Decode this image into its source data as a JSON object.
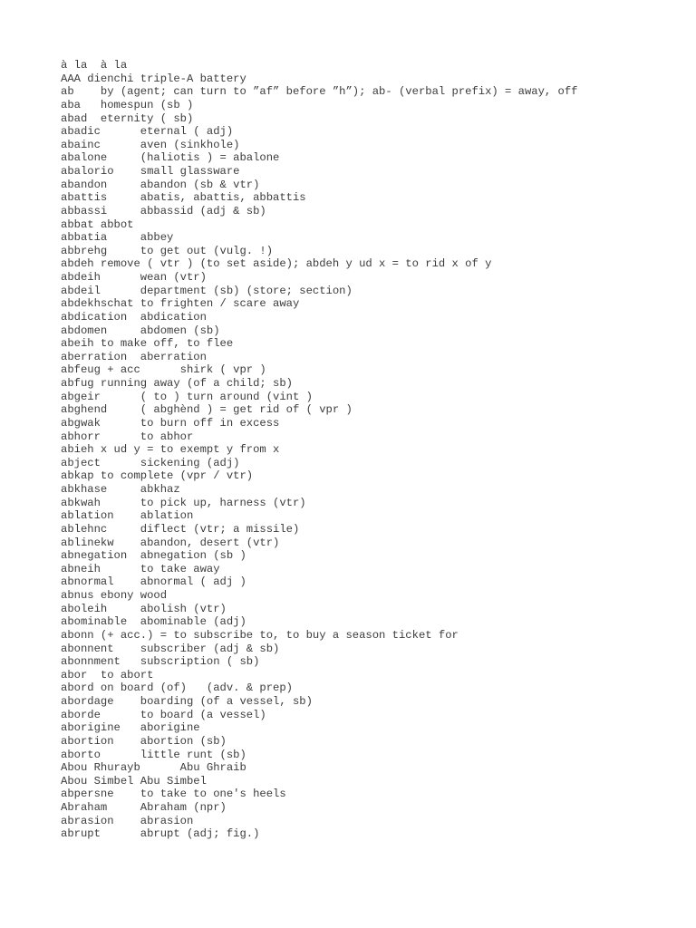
{
  "document": {
    "type": "glossary",
    "background_color": "#ffffff",
    "text_color": "#3c3c3c",
    "lines": [
      "à la  à la",
      "AAA dienchi triple-A battery",
      "ab    by (agent; can turn to ”af” before ”h”); ab- (verbal prefix) = away, off",
      "aba   homespun (sb )",
      "abad  eternity ( sb)",
      "abadic      eternal ( adj)",
      "abainc      aven (sinkhole)",
      "abalone     (haliotis ) = abalone",
      "abalorio    small glassware",
      "abandon     abandon (sb & vtr)",
      "abattis     abatis, abattis, abbattis",
      "abbassi     abbassid (adj & sb)",
      "abbat abbot",
      "abbatia     abbey",
      "abbrehg     to get out (vulg. !)",
      "abdeh remove ( vtr ) (to set aside); abdeh y ud x = to rid x of y",
      "abdeih      wean (vtr)",
      "abdeil      department (sb) (store; section)",
      "abdekhschat to frighten / scare away",
      "abdication  abdication",
      "abdomen     abdomen (sb)",
      "abeih to make off, to flee",
      "aberration  aberration",
      "abfeug + acc      shirk ( vpr )",
      "abfug running away (of a child; sb)",
      "abgeir      ( to ) turn around (vint )",
      "abghend     ( abghènd ) = get rid of ( vpr )",
      "abgwak      to burn off in excess",
      "abhorr      to abhor",
      "abieh x ud y = to exempt y from x",
      "abject      sickening (adj)",
      "abkap to complete (vpr / vtr)",
      "abkhase     abkhaz",
      "abkwah      to pick up, harness (vtr)",
      "ablation    ablation",
      "ablehnc     diflect (vtr; a missile)",
      "ablinekw    abandon, desert (vtr)",
      "abnegation  abnegation (sb )",
      "abneih      to take away",
      "abnormal    abnormal ( adj )",
      "abnus ebony wood",
      "aboleih     abolish (vtr)",
      "abominable  abominable (adj)",
      "abonn (+ acc.) = to subscribe to, to buy a season ticket for",
      "abonnent    subscriber (adj & sb)",
      "abonnment   subscription ( sb)",
      "abor  to abort",
      "abord on board (of)   (adv. & prep)",
      "abordage    boarding (of a vessel, sb)",
      "aborde      to board (a vessel)",
      "aborigine   aborigine",
      "abortion    abortion (sb)",
      "aborto      little runt (sb)",
      "Abou Rhurayb      Abu Ghraib",
      "Abou Simbel Abu Simbel",
      "abpersne    to take to one's heels",
      "Abraham     Abraham (npr)",
      "abrasion    abrasion",
      "abrupt      abrupt (adj; fig.)"
    ]
  }
}
